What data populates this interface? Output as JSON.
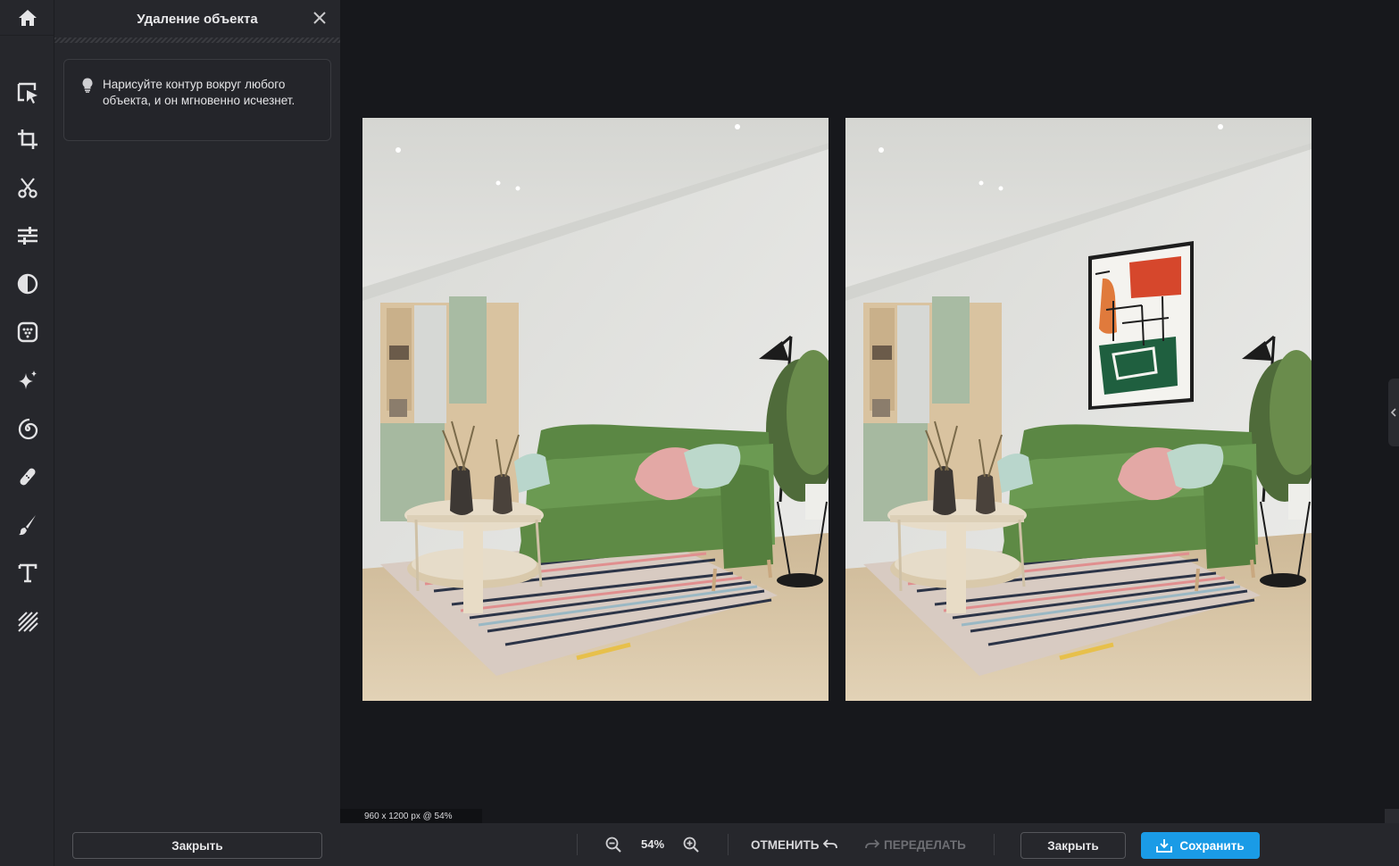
{
  "toolbar": {
    "tools": [
      "home-icon",
      "select-icon",
      "crop-icon",
      "cutout-icon",
      "adjust-icon",
      "filter-icon",
      "effects-icon",
      "magic-icon",
      "swirl-icon",
      "retouch-icon",
      "brush-icon",
      "text-icon",
      "texture-icon"
    ]
  },
  "panel": {
    "title": "Удаление объекта",
    "hint": "Нарисуйте контур вокруг любого объекта, и он мгновенно исчезнет.",
    "close_label": "Закрыть"
  },
  "canvas": {
    "image_info": "960 x 1200 px @ 54%"
  },
  "bottombar": {
    "zoom": "54%",
    "undo_label": "ОТМЕНИТЬ",
    "redo_label": "ПЕРЕДЕЛАТЬ",
    "close_label": "Закрыть",
    "save_label": "Сохранить"
  },
  "colors": {
    "accent": "#1a9be6",
    "sofa": "#5e8a45",
    "wall": "#e6e6e2",
    "floor": "#ddc9a8"
  }
}
